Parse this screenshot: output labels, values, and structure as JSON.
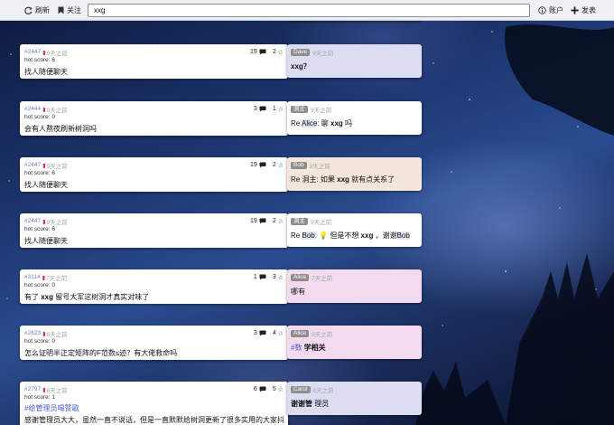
{
  "toolbar": {
    "refresh_label": "刷新",
    "follow_label": "关注",
    "search_value": "xxg",
    "account_label": "账户",
    "post_label": "发表"
  },
  "posts": [
    {
      "id": "#2447",
      "ago": "9天之前",
      "comments": "19",
      "stars": "2",
      "hot": "hot score: 6",
      "text": "找人随便聊天",
      "reply": {
        "author": "Dave",
        "ago": "9天之前",
        "color": "#dcdcf3",
        "text": "xxg？"
      }
    },
    {
      "id": "#2444",
      "ago": "9天之前",
      "comments": "3",
      "stars": "1",
      "hot": "hot score: 0",
      "text": "会有人熬夜刷新树洞吗",
      "reply": {
        "author": "洞主",
        "ago": "9天之前",
        "color": "#ffffff",
        "pre": "Re ",
        "name": "Alice",
        "mid": ": 聊 ",
        "strong": "xxg",
        "post": " 吗"
      }
    },
    {
      "id": "#2447",
      "ago": "9天之前",
      "comments": "19",
      "stars": "2",
      "hot": "hot score: 6",
      "text": "找人随便聊天",
      "reply": {
        "author": "Bob",
        "ago": "9天之前",
        "color": "#f5e6db",
        "pre": "Re 洞主: 如果 ",
        "strong": "xxg",
        "post": " 就有点关系了"
      }
    },
    {
      "id": "#2447",
      "ago": "9天之前",
      "comments": "19",
      "stars": "2",
      "hot": "hot score: 6",
      "text": "找人随便聊天",
      "reply": {
        "author": "洞主",
        "ago": "9天之前",
        "color": "#ffffff",
        "pre": "Re ",
        "name": "Bob",
        "mid": ": 💡 但是不想 ",
        "strong": "xxg",
        "post": " ，谢谢",
        "name2": "Bob"
      }
    },
    {
      "id": "#3114",
      "ago": "7天之前",
      "comments": "1",
      "stars": "3",
      "hot": "hot score: 0",
      "text_pre": "有了 ",
      "text_strong": "xxg",
      "text_post": " 留号大军这树洞才真实对味了",
      "reply": {
        "author": "Alice",
        "ago": "7天之前",
        "color": "#f4daee",
        "text": "哪有"
      }
    },
    {
      "id": "#2623",
      "ago": "8天之前",
      "comments": "3",
      "stars": "4",
      "hot": "hot score: 0",
      "text": "怎么证明半正定矩阵的F范数≤迹？有大佬救命吗",
      "reply": {
        "author": "Alice",
        "ago": "8天之前",
        "color": "#f4daee",
        "link": "#数",
        "strong": " 学相关"
      }
    },
    {
      "id": "#2797",
      "ago": "8天之前",
      "comments": "6",
      "stars": "5",
      "hot": "hot score: 1",
      "link_text": "#给管理员喝赞歌",
      "text2": "感谢管理员大大，虽然一直不说话，但是一直默默给树洞更新了很多实用的大家抖",
      "reply": {
        "author": "Carol",
        "ago": "8天之前",
        "color": "#dcdcf3",
        "strong": "谢谢管",
        "post": " 理员"
      }
    }
  ]
}
